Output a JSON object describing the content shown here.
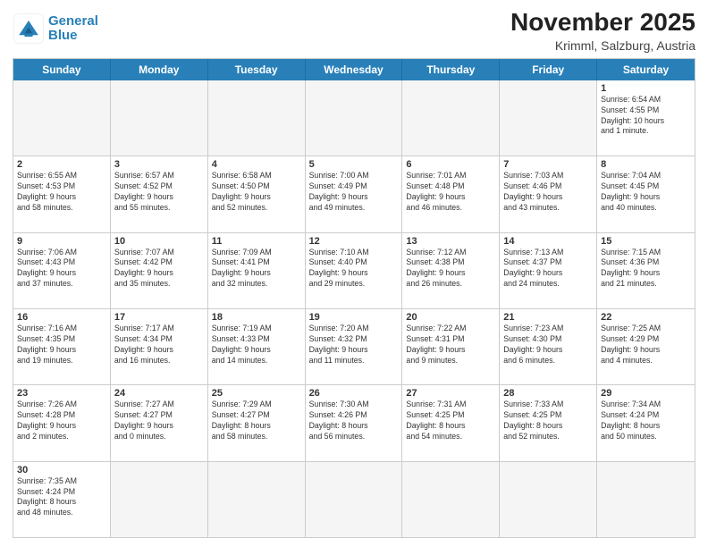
{
  "logo": {
    "line1": "General",
    "line2": "Blue"
  },
  "title": "November 2025",
  "subtitle": "Krimml, Salzburg, Austria",
  "header_days": [
    "Sunday",
    "Monday",
    "Tuesday",
    "Wednesday",
    "Thursday",
    "Friday",
    "Saturday"
  ],
  "rows": [
    [
      {
        "day": "",
        "info": "",
        "empty": true
      },
      {
        "day": "",
        "info": "",
        "empty": true
      },
      {
        "day": "",
        "info": "",
        "empty": true
      },
      {
        "day": "",
        "info": "",
        "empty": true
      },
      {
        "day": "",
        "info": "",
        "empty": true
      },
      {
        "day": "",
        "info": "",
        "empty": true
      },
      {
        "day": "1",
        "info": "Sunrise: 6:54 AM\nSunset: 4:55 PM\nDaylight: 10 hours\nand 1 minute.",
        "empty": false
      }
    ],
    [
      {
        "day": "2",
        "info": "Sunrise: 6:55 AM\nSunset: 4:53 PM\nDaylight: 9 hours\nand 58 minutes.",
        "empty": false
      },
      {
        "day": "3",
        "info": "Sunrise: 6:57 AM\nSunset: 4:52 PM\nDaylight: 9 hours\nand 55 minutes.",
        "empty": false
      },
      {
        "day": "4",
        "info": "Sunrise: 6:58 AM\nSunset: 4:50 PM\nDaylight: 9 hours\nand 52 minutes.",
        "empty": false
      },
      {
        "day": "5",
        "info": "Sunrise: 7:00 AM\nSunset: 4:49 PM\nDaylight: 9 hours\nand 49 minutes.",
        "empty": false
      },
      {
        "day": "6",
        "info": "Sunrise: 7:01 AM\nSunset: 4:48 PM\nDaylight: 9 hours\nand 46 minutes.",
        "empty": false
      },
      {
        "day": "7",
        "info": "Sunrise: 7:03 AM\nSunset: 4:46 PM\nDaylight: 9 hours\nand 43 minutes.",
        "empty": false
      },
      {
        "day": "8",
        "info": "Sunrise: 7:04 AM\nSunset: 4:45 PM\nDaylight: 9 hours\nand 40 minutes.",
        "empty": false
      }
    ],
    [
      {
        "day": "9",
        "info": "Sunrise: 7:06 AM\nSunset: 4:43 PM\nDaylight: 9 hours\nand 37 minutes.",
        "empty": false
      },
      {
        "day": "10",
        "info": "Sunrise: 7:07 AM\nSunset: 4:42 PM\nDaylight: 9 hours\nand 35 minutes.",
        "empty": false
      },
      {
        "day": "11",
        "info": "Sunrise: 7:09 AM\nSunset: 4:41 PM\nDaylight: 9 hours\nand 32 minutes.",
        "empty": false
      },
      {
        "day": "12",
        "info": "Sunrise: 7:10 AM\nSunset: 4:40 PM\nDaylight: 9 hours\nand 29 minutes.",
        "empty": false
      },
      {
        "day": "13",
        "info": "Sunrise: 7:12 AM\nSunset: 4:38 PM\nDaylight: 9 hours\nand 26 minutes.",
        "empty": false
      },
      {
        "day": "14",
        "info": "Sunrise: 7:13 AM\nSunset: 4:37 PM\nDaylight: 9 hours\nand 24 minutes.",
        "empty": false
      },
      {
        "day": "15",
        "info": "Sunrise: 7:15 AM\nSunset: 4:36 PM\nDaylight: 9 hours\nand 21 minutes.",
        "empty": false
      }
    ],
    [
      {
        "day": "16",
        "info": "Sunrise: 7:16 AM\nSunset: 4:35 PM\nDaylight: 9 hours\nand 19 minutes.",
        "empty": false
      },
      {
        "day": "17",
        "info": "Sunrise: 7:17 AM\nSunset: 4:34 PM\nDaylight: 9 hours\nand 16 minutes.",
        "empty": false
      },
      {
        "day": "18",
        "info": "Sunrise: 7:19 AM\nSunset: 4:33 PM\nDaylight: 9 hours\nand 14 minutes.",
        "empty": false
      },
      {
        "day": "19",
        "info": "Sunrise: 7:20 AM\nSunset: 4:32 PM\nDaylight: 9 hours\nand 11 minutes.",
        "empty": false
      },
      {
        "day": "20",
        "info": "Sunrise: 7:22 AM\nSunset: 4:31 PM\nDaylight: 9 hours\nand 9 minutes.",
        "empty": false
      },
      {
        "day": "21",
        "info": "Sunrise: 7:23 AM\nSunset: 4:30 PM\nDaylight: 9 hours\nand 6 minutes.",
        "empty": false
      },
      {
        "day": "22",
        "info": "Sunrise: 7:25 AM\nSunset: 4:29 PM\nDaylight: 9 hours\nand 4 minutes.",
        "empty": false
      }
    ],
    [
      {
        "day": "23",
        "info": "Sunrise: 7:26 AM\nSunset: 4:28 PM\nDaylight: 9 hours\nand 2 minutes.",
        "empty": false
      },
      {
        "day": "24",
        "info": "Sunrise: 7:27 AM\nSunset: 4:27 PM\nDaylight: 9 hours\nand 0 minutes.",
        "empty": false
      },
      {
        "day": "25",
        "info": "Sunrise: 7:29 AM\nSunset: 4:27 PM\nDaylight: 8 hours\nand 58 minutes.",
        "empty": false
      },
      {
        "day": "26",
        "info": "Sunrise: 7:30 AM\nSunset: 4:26 PM\nDaylight: 8 hours\nand 56 minutes.",
        "empty": false
      },
      {
        "day": "27",
        "info": "Sunrise: 7:31 AM\nSunset: 4:25 PM\nDaylight: 8 hours\nand 54 minutes.",
        "empty": false
      },
      {
        "day": "28",
        "info": "Sunrise: 7:33 AM\nSunset: 4:25 PM\nDaylight: 8 hours\nand 52 minutes.",
        "empty": false
      },
      {
        "day": "29",
        "info": "Sunrise: 7:34 AM\nSunset: 4:24 PM\nDaylight: 8 hours\nand 50 minutes.",
        "empty": false
      }
    ],
    [
      {
        "day": "30",
        "info": "Sunrise: 7:35 AM\nSunset: 4:24 PM\nDaylight: 8 hours\nand 48 minutes.",
        "empty": false
      },
      {
        "day": "",
        "info": "",
        "empty": true
      },
      {
        "day": "",
        "info": "",
        "empty": true
      },
      {
        "day": "",
        "info": "",
        "empty": true
      },
      {
        "day": "",
        "info": "",
        "empty": true
      },
      {
        "day": "",
        "info": "",
        "empty": true
      },
      {
        "day": "",
        "info": "",
        "empty": true
      }
    ]
  ]
}
